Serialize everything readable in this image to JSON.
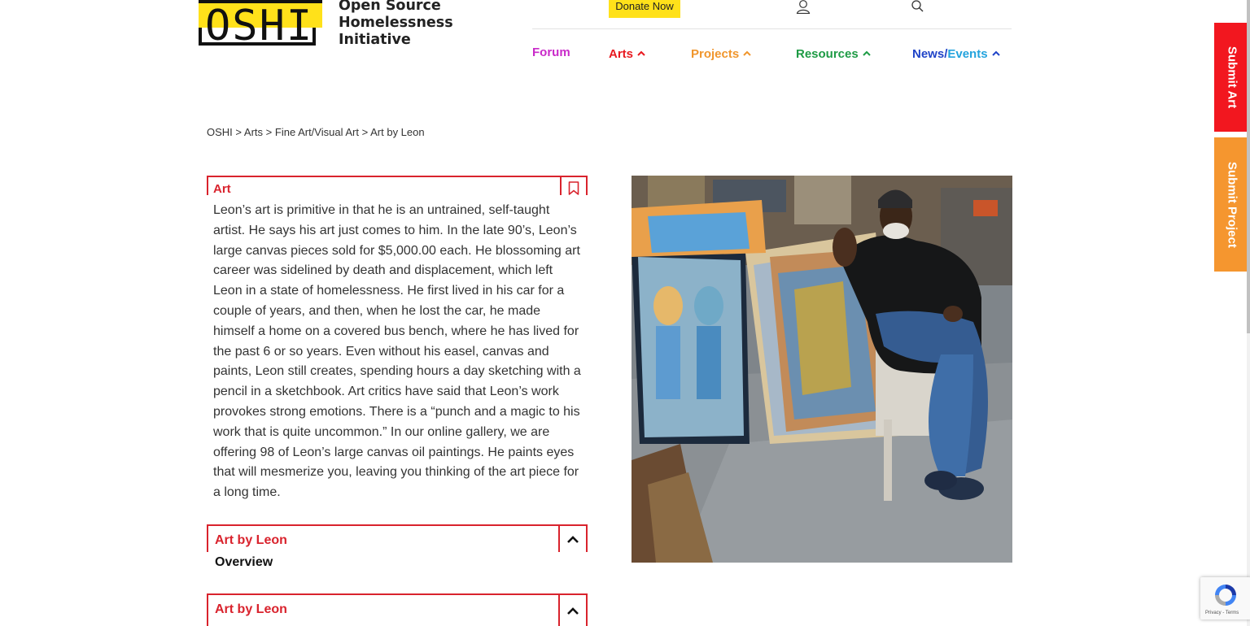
{
  "header": {
    "logo_text": "OSHI",
    "org_name_lines": [
      "Open Source",
      "Homelessness",
      "Initiative"
    ],
    "donate_label": "Donate Now"
  },
  "nav": {
    "forum": "Forum",
    "arts": "Arts",
    "projects": "Projects",
    "resources": "Resources",
    "news": "News",
    "news_sep": "/",
    "events": "Events",
    "colors": {
      "forum": "#c92ac9",
      "arts": "#e8191f",
      "projects": "#f0962d",
      "resources": "#1e9b45",
      "news": "#2044c8",
      "events": "#23a3dd"
    }
  },
  "breadcrumb": {
    "items": [
      "OSHI",
      "Arts",
      "Fine Art/Visual Art",
      "Art by Leon"
    ],
    "separator": ">"
  },
  "art_panel": {
    "title": "Art",
    "body": "Leon’s art is primitive in that he is an untrained, self-taught artist. He says his art just comes to him. In the late 90’s, Leon’s large canvas pieces sold for $5,000.00 each. He blossoming art career was sidelined by death and displacement, which left Leon in a state of homelessness. He first lived in his car for a couple of years, and then, when he lost the car, he made himself a home on a covered bus bench, where he has lived for the past 6 or so years. Even without his easel, canvas and paints, Leon still creates, spending hours a day sketching with a pencil in a sketchbook. Art critics have said that Leon’s work provokes strong emotions. There is a “punch and a magic to his work that is quite uncommon.” In our online gallery, we are offering 98 of Leon’s large canvas oil paintings. He paints eyes that will mesmerize you, leaving you thinking of the art piece for a long time."
  },
  "accordions": [
    {
      "title": "Art by Leon",
      "subtitle": "Overview"
    },
    {
      "title": "Art by Leon"
    }
  ],
  "side_tabs": {
    "submit_art": "Submit Art",
    "submit_project": "Submit Project",
    "submit_art_color": "#f2171f",
    "submit_project_color": "#f5962f"
  },
  "recaptcha": {
    "privacy": "Privacy",
    "terms": "Terms"
  },
  "icons": [
    "user-icon",
    "search-icon",
    "bookmark-icon",
    "chevron-up-icon",
    "recaptcha-icon"
  ]
}
